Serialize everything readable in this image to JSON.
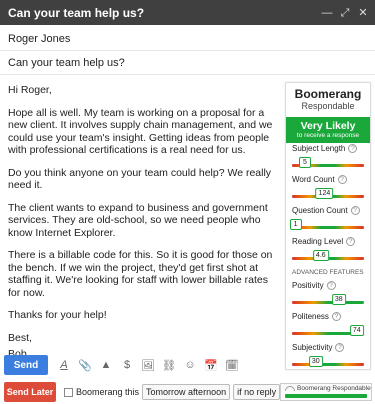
{
  "window": {
    "title": "Can your team help us?",
    "controls": [
      "—",
      "⤢",
      "✕"
    ]
  },
  "compose": {
    "to": "Roger Jones",
    "subject": "Can your team help us?",
    "body": [
      "Hi Roger,",
      "Hope all is well. My team is working on a proposal for a new client. It involves supply chain management, and we could use your team's insight. Getting ideas from people with professional certifications is a real need for us.",
      "Do you think anyone on your team could help? We really need it.",
      "The client wants to expand to business and government services. They are old-school, so we need people who know Internet Explorer.",
      "There is a billable code for this. So it is good for those on the bench. If we win the project, they'd get first shot at staffing it. We're looking for staff with lower billable rates for now.",
      "Thanks for your help!",
      "Best,",
      "Bob"
    ]
  },
  "panel": {
    "brand": "Boomerang",
    "subtitle": "Respondable",
    "prediction": "Very Likely",
    "prediction_sub": "to receive a response",
    "advanced_label": "ADVANCED FEATURES",
    "metrics": [
      {
        "label": "Subject Length",
        "value": "5",
        "level": 0.18
      },
      {
        "label": "Word Count",
        "value": "124",
        "level": 0.45
      },
      {
        "label": "Question Count",
        "value": "1",
        "level": 0.05
      },
      {
        "label": "Reading Level",
        "value": "4.6",
        "level": 0.4
      }
    ],
    "advanced": [
      {
        "label": "Positivity",
        "value": "38",
        "level": 0.65
      },
      {
        "label": "Politeness",
        "value": "74",
        "level": 0.9
      },
      {
        "label": "Subjectivity",
        "value": "30",
        "level": 0.33
      }
    ]
  },
  "toolbar": {
    "send_label": "Send",
    "tools": [
      "A",
      "📎",
      "▲",
      "$",
      "🖼",
      "⛓",
      "☺",
      "📅",
      "🗓"
    ]
  },
  "bottombar": {
    "send_later_label": "Send Later",
    "boomerang_label": "Boomerang this",
    "when": "Tomorrow afternoon",
    "condition": "if no reply",
    "help": "?",
    "respondable_label": "Boomerang Respondable"
  }
}
